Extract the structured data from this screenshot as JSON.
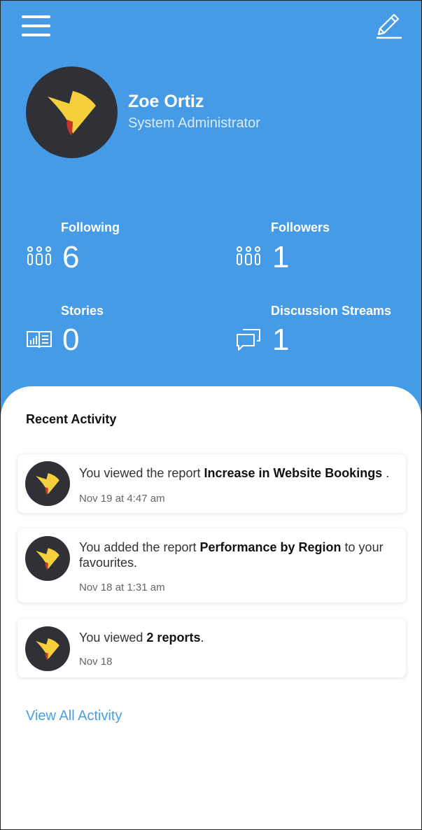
{
  "header": {
    "menu_icon": "hamburger-menu-icon",
    "edit_icon": "pencil-icon"
  },
  "profile": {
    "name": "Zoe Ortiz",
    "role": "System Administrator"
  },
  "stats": [
    {
      "label": "Following",
      "value": "6",
      "icon": "people-icon"
    },
    {
      "label": "Followers",
      "value": "1",
      "icon": "people-icon"
    },
    {
      "label": "Stories",
      "value": "0",
      "icon": "book-chart-icon"
    },
    {
      "label": "Discussion Streams",
      "value": "1",
      "icon": "chat-bubbles-icon"
    }
  ],
  "recent": {
    "title": "Recent Activity",
    "items": [
      {
        "pre": "You viewed the report ",
        "bold": "Increase in Website Bookings",
        "post": " .",
        "time": "Nov 19 at 4:47 am"
      },
      {
        "pre": "You added the report ",
        "bold": "Performance by Region",
        "post": " to your favourites.",
        "time": "Nov 18 at 1:31 am"
      },
      {
        "pre": "You viewed ",
        "bold": "2 reports",
        "post": ".",
        "time": "Nov 18"
      }
    ],
    "view_all": "View All Activity"
  },
  "colors": {
    "hero_bg": "#469BE6",
    "avatar_bg": "#2F3137",
    "logo_yellow": "#F6D03C",
    "logo_red": "#C8342A",
    "link": "#4A9FE0"
  }
}
